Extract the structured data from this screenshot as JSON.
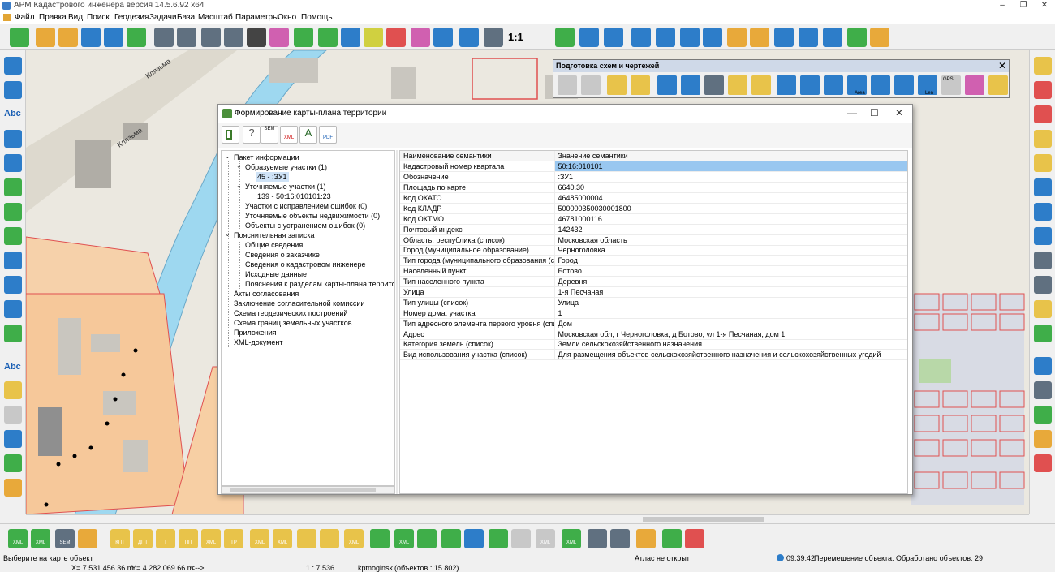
{
  "window": {
    "title": "АРМ Кадастрового инженера версия 14.5.6.92 x64",
    "minimize": "–",
    "maximize": "❐",
    "close": "✕"
  },
  "menu": [
    "Файл",
    "Правка",
    "Вид",
    "Поиск",
    "Геодезия",
    "Задачи",
    "База",
    "Масштаб",
    "Параметры",
    "Окно",
    "Помощь"
  ],
  "toolbar": {
    "zoom_label": "1:1",
    "icon_colors": [
      "#3fae49",
      "#e8a93a",
      "#e8a93a",
      "#2d7dc9",
      "#2d7dc9",
      "#3fae49",
      "#607080",
      "#607080",
      "#607080",
      "#607080",
      "#444444",
      "#d060b0",
      "#3fae49",
      "#3fae49",
      "#2d7dc9",
      "#d0d040",
      "#e05050",
      "#d060b0",
      "#2d7dc9",
      "#2d7dc9",
      "#607080",
      "#2d7dc9",
      "#3fae49",
      "#2d7dc9",
      "#2d7dc9",
      "#2d7dc9",
      "#2d7dc9",
      "#2d7dc9",
      "#2d7dc9",
      "#e8a93a",
      "#e8a93a",
      "#2d7dc9",
      "#2d7dc9",
      "#2d7dc9"
    ]
  },
  "left_tools": {
    "abc1": "Abc",
    "abc2": "Abc"
  },
  "toolbox": {
    "title": "Подготовка схем и чертежей",
    "close": "✕",
    "area_label": "Area",
    "len_label": "Len",
    "gps_label": "GPS"
  },
  "dialog": {
    "title": "Формирование карты-плана территории",
    "minimize": "—",
    "maximize": "☐",
    "close": "✕",
    "tb_labels": {
      "sem": "SEM",
      "xml": "XML",
      "pdf": "PDF"
    },
    "tree": [
      {
        "id": "t0",
        "label": "Пакет информации",
        "toggle": "⌄"
      },
      {
        "id": "t1",
        "label": "Образуемые участки (1)",
        "toggle": "⌄"
      },
      {
        "id": "t2",
        "label": "45 - :ЗУ1",
        "selected": true
      },
      {
        "id": "t3",
        "label": "Уточняемые участки (1)",
        "toggle": "⌄"
      },
      {
        "id": "t4",
        "label": "139 - 50:16:010101:23"
      },
      {
        "id": "t5",
        "label": "Участки с исправлением ошибок (0)"
      },
      {
        "id": "t6",
        "label": "Уточняемые объекты недвижимости (0)"
      },
      {
        "id": "t7",
        "label": "Объекты с устранением ошибок (0)"
      },
      {
        "id": "t8",
        "label": "Пояснительная записка",
        "toggle": "⌄"
      },
      {
        "id": "t9",
        "label": "Общие сведения"
      },
      {
        "id": "t10",
        "label": "Сведения о заказчике"
      },
      {
        "id": "t11",
        "label": "Сведения о кадастровом инженере"
      },
      {
        "id": "t12",
        "label": "Исходные данные"
      },
      {
        "id": "t13",
        "label": "Пояснения к разделам карты-плана территор"
      },
      {
        "id": "t14",
        "label": "Акты согласования"
      },
      {
        "id": "t15",
        "label": "Заключение согласительной комиссии"
      },
      {
        "id": "t16",
        "label": "Схема геодезических построений"
      },
      {
        "id": "t17",
        "label": "Схема границ земельных участков"
      },
      {
        "id": "t18",
        "label": "Приложения"
      },
      {
        "id": "t19",
        "label": "XML-документ"
      }
    ],
    "grid": {
      "headers": [
        "Наименование семантики",
        "Значение семантики"
      ],
      "rows": [
        [
          "Кадастровый номер квартала",
          "50:16:010101"
        ],
        [
          "Обозначение",
          ":ЗУ1"
        ],
        [
          "Площадь по карте",
          "6640.30"
        ],
        [
          "Код ОКАТО",
          "46485000004"
        ],
        [
          "Код КЛАДР",
          "500000350030001800"
        ],
        [
          "Код ОКТМО",
          "46781000116"
        ],
        [
          "Почтовый индекс",
          "142432"
        ],
        [
          "Область, республика (список)",
          "Московская область"
        ],
        [
          "Город (муниципальное образование)",
          "Черноголовка"
        ],
        [
          "Тип города (муниципального образования (спис",
          "Город"
        ],
        [
          "Населенный пункт",
          "Ботово"
        ],
        [
          "Тип населенного пункта",
          "Деревня"
        ],
        [
          "Улица",
          "1-я Песчаная"
        ],
        [
          "Тип улицы (список)",
          "Улица"
        ],
        [
          "Номер дома, участка",
          "1"
        ],
        [
          "Тип адресного элемента первого уровня (спис",
          "Дом"
        ],
        [
          "Адрес",
          "Московская обл, г Черноголовка, д Ботово, ул 1-я Песчаная, дом 1"
        ],
        [
          "Категория земель (список)",
          "Земли сельскохозяйственного назначения"
        ],
        [
          "Вид использования участка (список)",
          "Для размещения объектов сельскохозяйственного назначения и сельскохозяйственных угодий"
        ]
      ]
    }
  },
  "map": {
    "street1": "Клязьма",
    "street2": "Клязьма"
  },
  "bottom_toolbar": {
    "labels": [
      "XML",
      "XML",
      "SEM",
      "",
      "КПТ",
      "ДПТ",
      "Т",
      "ПП",
      "XML",
      "ТР",
      "XML",
      "XML",
      "",
      "",
      "XML",
      "",
      "XML",
      "",
      "",
      "",
      "",
      "",
      "XML",
      "XML",
      "",
      "",
      ""
    ]
  },
  "status": {
    "hint": "Выберите на карте объект",
    "x": "X=  7 531 456.36 m",
    "y": "Y= 4 282 069.66 m",
    "arrows": "<-->",
    "scale": "1 : 7 536",
    "map_name": "kptnoginsk",
    "objects": "(объектов : 15 802)",
    "atlas": "Атлас не открыт",
    "time": "09:39:42",
    "message": "Перемещение объекта. Обработано объектов:  29"
  }
}
